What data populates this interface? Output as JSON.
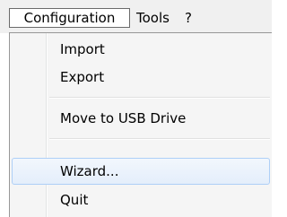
{
  "menubar": {
    "items": [
      {
        "label": "Configuration"
      },
      {
        "label": "Tools"
      },
      {
        "label": "?"
      }
    ]
  },
  "dropdown": {
    "items": [
      {
        "label": "Import"
      },
      {
        "label": "Export"
      },
      {
        "label": "Move to USB Drive"
      },
      {
        "label": "Wizard...",
        "highlighted": true
      },
      {
        "label": "Quit"
      }
    ]
  },
  "colors": {
    "menubar_bg": "#f0f0f0",
    "menu_bg": "#f5f5f5",
    "highlight_border": "#aecff7",
    "highlight_fill": "#e4eefb"
  }
}
